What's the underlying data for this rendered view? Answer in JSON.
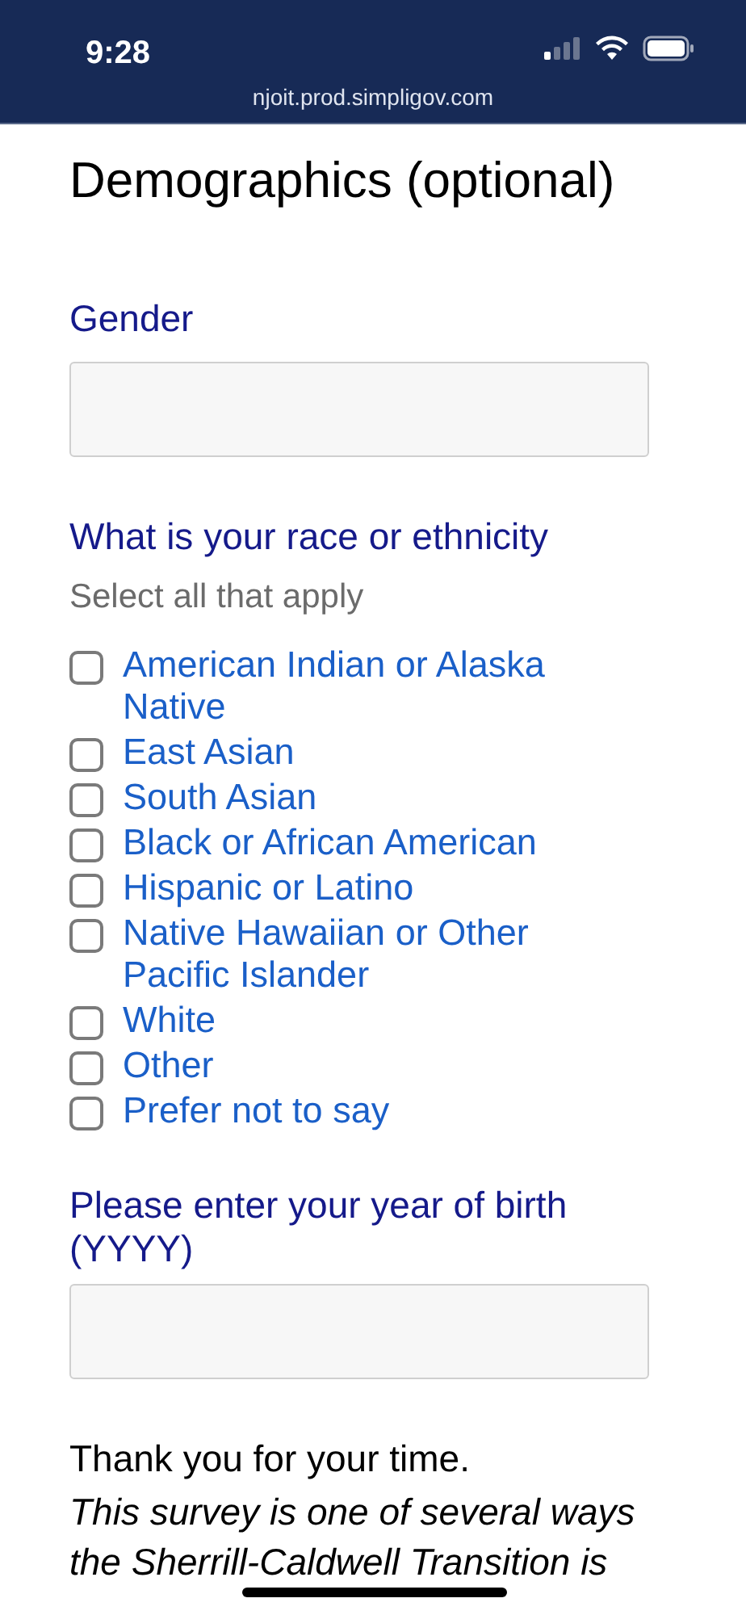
{
  "status_bar": {
    "time": "9:28",
    "url": "njoit.prod.simpligov.com"
  },
  "heading": "Demographics (optional)",
  "gender": {
    "label": "Gender"
  },
  "race": {
    "label": "What is your race or ethnicity",
    "hint": "Select all that apply",
    "options": [
      {
        "label": "American Indian or Alaska Native",
        "checked": false
      },
      {
        "label": "East Asian",
        "checked": false
      },
      {
        "label": "South Asian",
        "checked": false
      },
      {
        "label": "Black or African American",
        "checked": false
      },
      {
        "label": "Hispanic or Latino",
        "checked": false
      },
      {
        "label": "Native Hawaiian or Other Pacific Islander",
        "checked": false
      },
      {
        "label": "White",
        "checked": false
      },
      {
        "label": "Other",
        "checked": false
      },
      {
        "label": "Prefer not to say",
        "checked": false
      }
    ]
  },
  "birth_year": {
    "label": "Please enter your year of birth (YYYY)"
  },
  "thanks": "Thank you for your time.",
  "note": "This survey is one of several ways the Sherrill-Caldwell Transition is"
}
